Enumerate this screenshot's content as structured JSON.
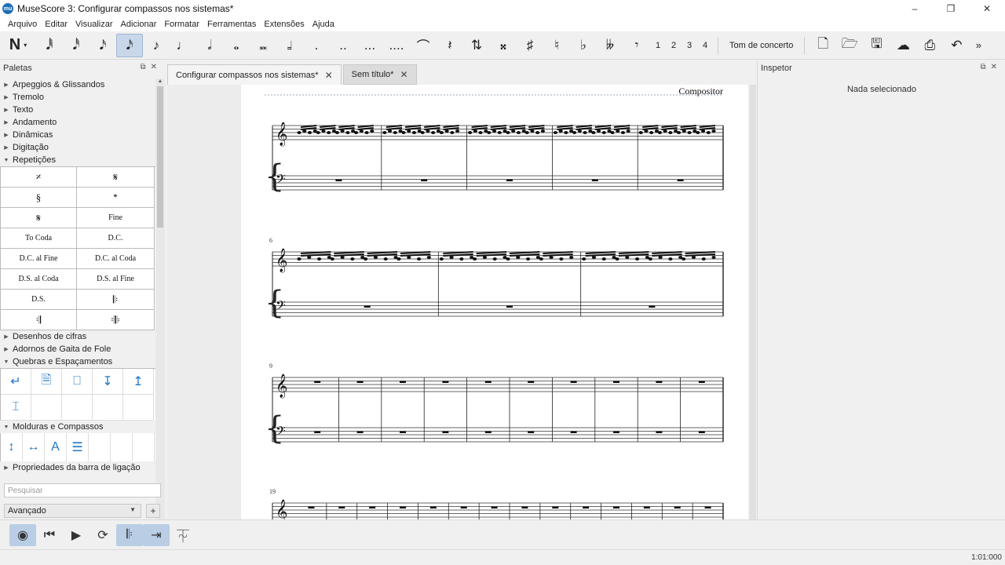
{
  "window": {
    "title": "MuseScore 3: Configurar compassos nos sistemas*",
    "app_icon": "mu",
    "controls": [
      "–",
      "❐",
      "✕"
    ]
  },
  "menu": [
    "Arquivo",
    "Editar",
    "Visualizar",
    "Adicionar",
    "Formatar",
    "Ferramentas",
    "Extensões",
    "Ajuda"
  ],
  "toolbar": {
    "voices": [
      "1",
      "2",
      "3",
      "4"
    ],
    "concert_pitch": "Tom de concerto",
    "more": "»"
  },
  "palettes": {
    "title": "Paletas",
    "collapsed_top": [
      "Arpeggios & Glissandos",
      "Tremolo",
      "Texto",
      "Andamento",
      "Dinâmicas",
      "Digitação"
    ],
    "repeats_title": "Repetições",
    "repeats_cells": [
      "𝄎",
      "𝄋",
      "§",
      "𝄌",
      "𝄋",
      "Fine",
      "To Coda",
      "D.C.",
      "D.C. al Fine",
      "D.C. al Coda",
      "D.S. al Coda",
      "D.S. al Fine",
      "D.S.",
      "𝄆",
      "𝄇",
      "𝄇𝄆"
    ],
    "collapsed_mid": [
      "Desenhos de cifras",
      "Adornos de Gaita de Fole"
    ],
    "breaks_title": "Quebras e Espaçamentos",
    "frames_title": "Molduras e Compassos",
    "collapsed_bottom": [
      "Propriedades da barra de ligação"
    ],
    "search_placeholder": "Pesquisar",
    "workspace": "Avançado",
    "add": "+"
  },
  "tabs": [
    {
      "label": "Configurar compassos nos sistemas*",
      "close": "✕"
    },
    {
      "label": "Sem título*",
      "close": "✕"
    }
  ],
  "score": {
    "composer": "Compositor",
    "systems": [
      {
        "number": "",
        "measures": 5
      },
      {
        "number": "6",
        "measures": 3
      },
      {
        "number": "9",
        "measures": 10
      },
      {
        "number": "19",
        "measures": 14
      }
    ]
  },
  "inspector": {
    "title": "Inspetor",
    "empty": "Nada selecionado"
  },
  "status": {
    "time": "1:01:000"
  }
}
